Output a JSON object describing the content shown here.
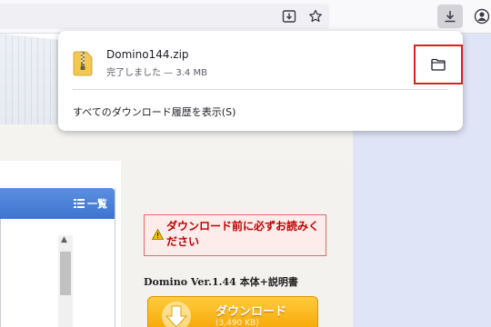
{
  "toolbar": {
    "icons": [
      "save-page-icon",
      "bookmark-star-icon",
      "downloads-icon",
      "account-icon"
    ]
  },
  "downloads_panel": {
    "item": {
      "file_name": "Domino144.zip",
      "status": "完了しました — 3.4 MB",
      "icon": "zip-file-icon",
      "action_icon": "folder-icon"
    },
    "show_all_label": "すべてのダウンロード履歴を表示(S)"
  },
  "page": {
    "nav": {
      "title": "一覧"
    },
    "warning": {
      "text": "ダウンロード前に必ずお読みください"
    },
    "product": {
      "title": "Domino Ver.1.44 本体+説明書",
      "download_label": "ダウンロード",
      "download_size": "(3,490 KB)"
    }
  },
  "colors": {
    "highlight": "#e02020",
    "download_button": "#f5a400",
    "nav_header": "#4a80d6",
    "warning_text": "#c00000"
  }
}
